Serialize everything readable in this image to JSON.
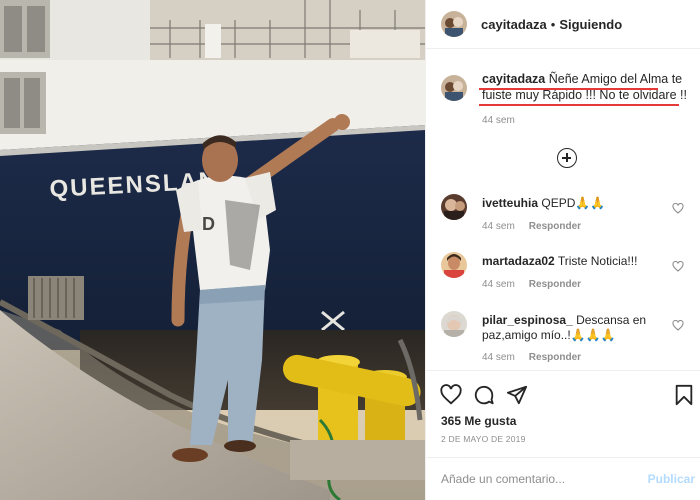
{
  "post": {
    "photo_icon": "instagram-post-photo",
    "ship_name": "QUEENSLAN"
  },
  "header": {
    "username": "cayitadaza",
    "separator": "•",
    "follow_status": "Siguiendo"
  },
  "caption": {
    "username": "cayitadaza",
    "text": "Ñeñe Amigo del Alma te fuiste muy Rápido !!! No te olvidare !!",
    "time": "44 sem",
    "highlight_color": "#e53838"
  },
  "load_more_icon": "plus-circle-icon",
  "comments": [
    {
      "username": "ivetteuhia",
      "text": "QEPD",
      "emoji": "🙏🙏",
      "time": "44 sem",
      "reply": "Responder"
    },
    {
      "username": "martadaza02",
      "text": "Triste Noticia!!!",
      "emoji": "",
      "time": "44 sem",
      "reply": "Responder"
    },
    {
      "username": "pilar_espinosa_",
      "text": "Descansa en paz,amigo mío..!",
      "emoji": "🙏🙏🙏",
      "time": "44 sem",
      "reply": "Responder"
    }
  ],
  "actions": {
    "like_icon": "heart-icon",
    "comment_icon": "comment-icon",
    "share_icon": "share-icon",
    "save_icon": "bookmark-icon"
  },
  "likes": "365 Me gusta",
  "date": "2 DE MAYO DE 2019",
  "add_comment": {
    "placeholder": "Añade un comentario...",
    "publish_label": "Publicar"
  }
}
